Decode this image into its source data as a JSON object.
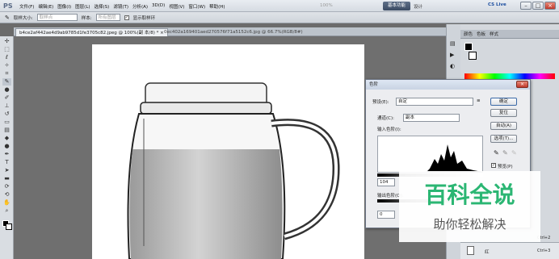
{
  "app": {
    "logo": "PS"
  },
  "menu": [
    "文件(F)",
    "编辑(E)",
    "图像(I)",
    "图层(L)",
    "选择(S)",
    "滤镜(T)",
    "分析(A)",
    "3D(D)",
    "视图(V)",
    "窗口(W)",
    "帮助(H)"
  ],
  "topbar": {
    "zoom": "100%",
    "essentials": "基本功能",
    "design": "设计",
    "cs_live": "CS Live"
  },
  "options": {
    "sample_size_label": "取样大小:",
    "sample_size_value": "取样点",
    "sample_label": "样本:",
    "sample_value": "所有图层",
    "show_ring": "显示取样环"
  },
  "tabs": {
    "tab1": "b4ce2af442ae4d9ab9785d1fe3705c82.jpeg @ 100%(副 本/8) *",
    "tab1_close": "×",
    "tab2": "0ec402a169401aed270576f71a5152c6.jpg @ 66.7%(RGB/8#)"
  },
  "panels": {
    "tabs": [
      "颜色",
      "色板",
      "样式"
    ],
    "layer_name": "红",
    "shortcut1": "Ctrl+2",
    "shortcut2": "Ctrl+3"
  },
  "dialog": {
    "title": "色阶",
    "preset_label": "预设(E):",
    "preset_value": "自定",
    "channel_label": "通道(C):",
    "channel_value": "副本",
    "input_label": "输入色阶(I):",
    "input_value": "104",
    "output_label": "输出色阶(O):",
    "output_value": "0",
    "buttons": {
      "ok": "确定",
      "reset": "复位",
      "auto": "自动(A)",
      "options": "选项(T)..."
    },
    "preview_label": "预览(P)"
  },
  "watermark": {
    "title": "百科全说",
    "subtitle": "助你轻松解决"
  }
}
